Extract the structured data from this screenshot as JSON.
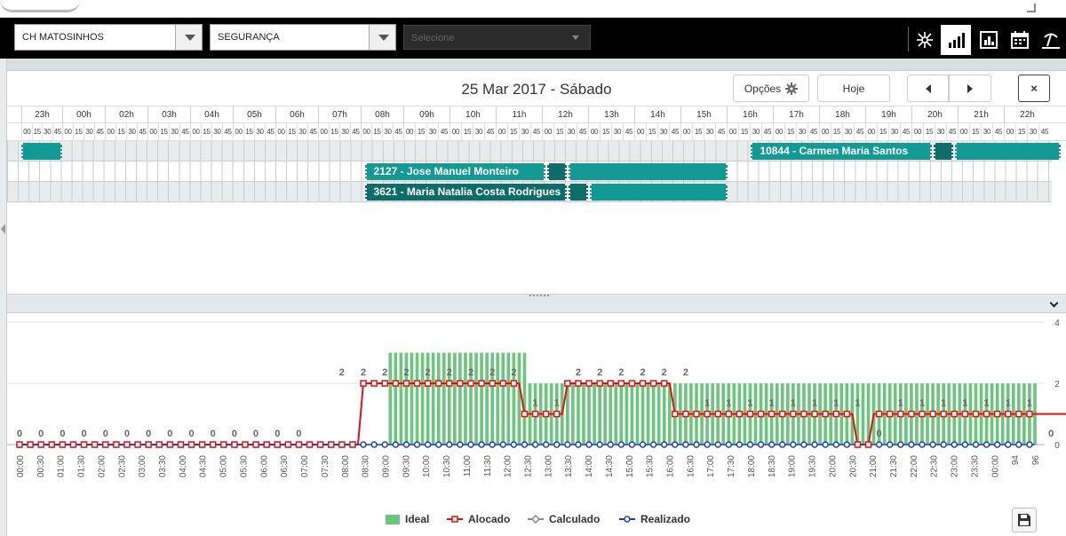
{
  "toolbar": {
    "location": {
      "value": "CH MATOSINHOS"
    },
    "department": {
      "value": "SEGURANÇA"
    },
    "extra": {
      "placeholder": "Selecione"
    },
    "icons": [
      "network-icon",
      "bar-chart-icon",
      "report-chart-icon",
      "calendar-icon",
      "beach-vacation-icon"
    ]
  },
  "header": {
    "date_label": "25 Mar 2017 - Sábado",
    "options_label": "Opções",
    "today_label": "Hoje",
    "close_label": "×"
  },
  "timeline": {
    "hours": [
      "23h",
      "00h",
      "02h",
      "03h",
      "04h",
      "05h",
      "06h",
      "07h",
      "08h",
      "09h",
      "10h",
      "11h",
      "12h",
      "13h",
      "14h",
      "15h",
      "16h",
      "17h",
      "18h",
      "19h",
      "20h",
      "21h",
      "22h"
    ],
    "minutes": [
      "00",
      "15",
      "30",
      "45"
    ]
  },
  "rows": [
    {
      "blocks": [
        {
          "start": 0,
          "end": 4,
          "label": "",
          "dark": false
        },
        {
          "start": 68,
          "end": 85,
          "label": "10844 - Carmen Maria Santos",
          "dark": false
        },
        {
          "start": 85,
          "end": 87,
          "label": "",
          "dark": true
        },
        {
          "start": 87,
          "end": 97,
          "label": "",
          "dark": false
        }
      ]
    },
    {
      "blocks": [
        {
          "start": 32,
          "end": 49,
          "label": "2127 - Jose Manuel Monteiro",
          "dark": false
        },
        {
          "start": 49,
          "end": 51,
          "label": "",
          "dark": true
        },
        {
          "start": 51,
          "end": 66,
          "label": "",
          "dark": false
        }
      ]
    },
    {
      "blocks": [
        {
          "start": 32,
          "end": 51,
          "label": "3621 - Maria Natalia Costa Rodrigues",
          "dark": true
        },
        {
          "start": 51,
          "end": 53,
          "label": "",
          "dark": true
        },
        {
          "start": 53,
          "end": 66,
          "label": "",
          "dark": false
        }
      ]
    }
  ],
  "chart_data": {
    "type": "bar",
    "x": [
      "00:00",
      "00:30",
      "01:00",
      "01:30",
      "02:00",
      "02:30",
      "03:00",
      "03:30",
      "04:00",
      "04:30",
      "05:00",
      "05:30",
      "06:00",
      "06:30",
      "07:00",
      "07:30",
      "08:00",
      "08:30",
      "09:00",
      "09:30",
      "10:00",
      "10:30",
      "11:00",
      "11:30",
      "12:00",
      "12:30",
      "13:00",
      "13:30",
      "14:00",
      "14:30",
      "15:00",
      "15:30",
      "16:00",
      "16:30",
      "17:00",
      "17:30",
      "18:00",
      "18:30",
      "19:00",
      "19:30",
      "20:00",
      "20:30",
      "21:00",
      "21:30",
      "22:00",
      "22:30",
      "23:00",
      "23:30",
      "00:00",
      "94",
      "96"
    ],
    "ylim": [
      0,
      4
    ],
    "yticks": [
      0,
      2,
      4
    ],
    "series": [
      {
        "name": "Ideal",
        "kind": "bar",
        "color": "#6cc57c",
        "values": [
          0,
          0,
          0,
          0,
          0,
          0,
          0,
          0,
          0,
          0,
          0,
          0,
          0,
          0,
          0,
          0,
          0,
          0,
          0,
          0,
          0,
          0,
          0,
          0,
          0,
          0,
          0,
          0,
          0,
          0,
          0,
          0,
          0,
          0,
          0,
          0,
          0,
          0,
          0,
          0,
          0,
          0,
          0,
          0,
          0,
          0,
          0,
          0,
          0,
          0,
          0,
          0,
          0,
          0,
          0,
          0,
          0,
          0,
          0,
          0,
          0,
          0,
          0,
          0,
          0,
          0,
          0,
          0,
          0,
          3,
          3,
          3,
          3,
          3,
          3,
          3,
          3,
          3,
          3,
          3,
          3,
          3,
          3,
          3,
          3,
          3,
          3,
          3,
          3,
          3,
          3,
          3,
          3,
          3,
          3,
          2,
          2,
          2,
          2,
          2,
          2,
          2,
          2,
          2,
          2,
          2,
          2,
          2,
          2,
          2,
          2,
          2,
          2,
          2,
          2,
          2,
          2,
          2,
          2,
          2,
          2,
          2,
          2,
          2,
          2,
          2,
          2,
          2,
          2,
          2,
          2,
          2,
          2,
          2,
          2,
          2,
          2,
          2,
          2,
          2,
          2,
          2,
          2,
          2,
          2,
          2,
          2,
          2,
          2,
          2,
          2,
          2,
          2,
          2,
          2,
          2,
          2,
          2,
          2,
          2,
          2,
          2,
          2,
          2,
          2,
          2,
          2,
          2,
          2,
          2,
          2,
          2,
          2,
          2,
          2,
          2,
          2,
          2,
          2,
          2,
          2,
          2,
          2,
          2,
          2,
          2,
          2,
          2,
          2,
          2
        ]
      },
      {
        "name": "Alocado",
        "kind": "line",
        "color": "#e01010",
        "values": [
          0,
          0,
          0,
          0,
          0,
          0,
          0,
          0,
          0,
          0,
          0,
          0,
          0,
          0,
          0,
          0,
          0,
          0,
          0,
          0,
          0,
          0,
          0,
          0,
          0,
          0,
          0,
          0,
          0,
          0,
          0,
          0,
          0,
          0,
          0,
          0,
          0,
          0,
          0,
          0,
          0,
          0,
          0,
          0,
          0,
          0,
          0,
          0,
          0,
          0,
          0,
          0,
          0,
          0,
          0,
          0,
          0,
          0,
          0,
          0,
          0,
          0,
          0,
          0,
          2,
          2,
          2,
          2,
          2,
          2,
          2,
          2,
          2,
          2,
          2,
          2,
          2,
          2,
          2,
          2,
          2,
          2,
          2,
          2,
          2,
          2,
          2,
          2,
          2,
          2,
          2,
          2,
          2,
          2,
          1,
          1,
          1,
          1,
          1,
          1,
          1,
          1,
          2,
          2,
          2,
          2,
          2,
          2,
          2,
          2,
          2,
          2,
          2,
          2,
          2,
          2,
          2,
          2,
          2,
          2,
          2,
          2,
          1,
          1,
          1,
          1,
          1,
          1,
          1,
          1,
          1,
          1,
          1,
          1,
          1,
          1,
          1,
          1,
          1,
          1,
          1,
          1,
          1,
          1,
          1,
          1,
          1,
          1,
          1,
          1,
          1,
          1,
          1,
          1,
          1,
          1,
          0,
          0,
          0,
          1,
          1,
          1,
          1,
          1,
          1,
          1,
          1,
          1,
          1,
          1,
          1,
          1,
          1,
          1,
          1,
          1,
          1,
          1,
          1,
          1,
          1,
          1,
          1,
          1,
          1,
          1,
          1,
          1,
          1,
          1,
          1,
          1,
          1,
          1,
          1,
          1,
          0,
          0,
          0,
          0,
          0,
          0,
          0,
          0,
          0,
          0,
          0,
          0,
          0,
          0,
          0,
          0
        ]
      },
      {
        "name": "Calculado",
        "kind": "line",
        "color": "#888888",
        "values": []
      },
      {
        "name": "Realizado",
        "kind": "line",
        "color": "#1a3fb5",
        "values": []
      }
    ],
    "data_labels": [
      {
        "x": 0,
        "y": 0,
        "text": "0"
      },
      {
        "x": 4,
        "y": 0,
        "text": "0"
      },
      {
        "x": 8,
        "y": 0,
        "text": "0"
      },
      {
        "x": 12,
        "y": 0,
        "text": "0"
      },
      {
        "x": 16,
        "y": 0,
        "text": "0"
      },
      {
        "x": 20,
        "y": 0,
        "text": "0"
      },
      {
        "x": 24,
        "y": 0,
        "text": "0"
      },
      {
        "x": 28,
        "y": 0,
        "text": "0"
      },
      {
        "x": 32,
        "y": 0,
        "text": "0"
      },
      {
        "x": 36,
        "y": 0,
        "text": "0"
      },
      {
        "x": 40,
        "y": 0,
        "text": "0"
      },
      {
        "x": 44,
        "y": 0,
        "text": "0"
      },
      {
        "x": 48,
        "y": 0,
        "text": "0"
      },
      {
        "x": 52,
        "y": 0,
        "text": "0"
      },
      {
        "x": 60,
        "y": 2,
        "text": "2"
      },
      {
        "x": 64,
        "y": 2,
        "text": "2"
      },
      {
        "x": 68,
        "y": 2,
        "text": "2"
      },
      {
        "x": 72,
        "y": 2,
        "text": "2"
      },
      {
        "x": 76,
        "y": 2,
        "text": "2"
      },
      {
        "x": 80,
        "y": 2,
        "text": "2"
      },
      {
        "x": 84,
        "y": 2,
        "text": "2"
      },
      {
        "x": 88,
        "y": 2,
        "text": "2"
      },
      {
        "x": 92,
        "y": 2,
        "text": "2"
      },
      {
        "x": 96,
        "y": 1,
        "text": "1"
      },
      {
        "x": 100,
        "y": 1,
        "text": "1"
      },
      {
        "x": 104,
        "y": 2,
        "text": "2"
      },
      {
        "x": 108,
        "y": 2,
        "text": "2"
      },
      {
        "x": 112,
        "y": 2,
        "text": "2"
      },
      {
        "x": 116,
        "y": 2,
        "text": "2"
      },
      {
        "x": 120,
        "y": 2,
        "text": "2"
      },
      {
        "x": 124,
        "y": 2,
        "text": "2"
      },
      {
        "x": 128,
        "y": 1,
        "text": "1"
      },
      {
        "x": 132,
        "y": 1,
        "text": "1"
      },
      {
        "x": 136,
        "y": 1,
        "text": "1"
      },
      {
        "x": 140,
        "y": 1,
        "text": "1"
      },
      {
        "x": 144,
        "y": 1,
        "text": "1"
      },
      {
        "x": 148,
        "y": 1,
        "text": "1"
      },
      {
        "x": 152,
        "y": 1,
        "text": "1"
      },
      {
        "x": 156,
        "y": 1,
        "text": "1"
      },
      {
        "x": 160,
        "y": 0,
        "text": "0"
      },
      {
        "x": 164,
        "y": 1,
        "text": "1"
      },
      {
        "x": 168,
        "y": 1,
        "text": "1"
      },
      {
        "x": 172,
        "y": 1,
        "text": "1"
      },
      {
        "x": 176,
        "y": 1,
        "text": "1"
      },
      {
        "x": 180,
        "y": 1,
        "text": "1"
      },
      {
        "x": 184,
        "y": 1,
        "text": "1"
      },
      {
        "x": 188,
        "y": 1,
        "text": "1"
      },
      {
        "x": 192,
        "y": 0,
        "text": "0"
      }
    ]
  },
  "legend": {
    "ideal": "Ideal",
    "alocado": "Alocado",
    "calculado": "Calculado",
    "realizado": "Realizado"
  },
  "colors": {
    "teal": "#149a95",
    "teal_dark": "#0e6c69",
    "ideal_green": "#6cc57c",
    "alocado_red": "#e01010",
    "realizado_blue": "#1a3fb5"
  }
}
